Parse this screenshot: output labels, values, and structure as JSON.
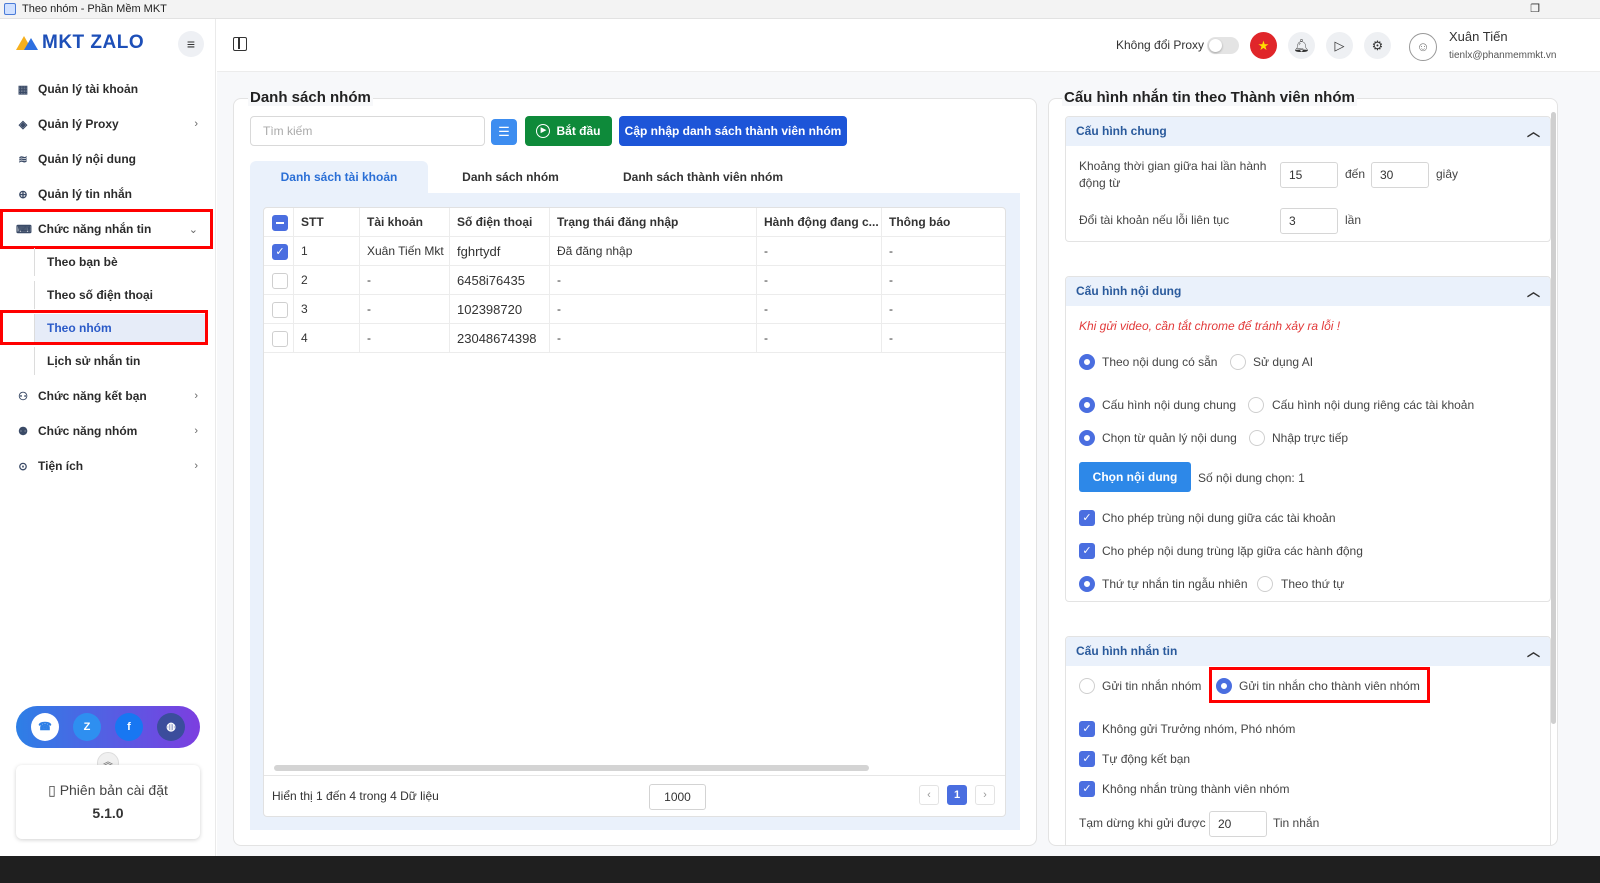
{
  "window": {
    "title": "Theo nhóm - Phần Mềm MKT"
  },
  "sidebar": {
    "logo": "MKT ZALO",
    "items": [
      {
        "label": "Quản lý tài khoản",
        "icon": "grid-icon"
      },
      {
        "label": "Quản lý Proxy",
        "icon": "layers-icon"
      },
      {
        "label": "Quản lý nội dung",
        "icon": "content-icon"
      },
      {
        "label": "Quản lý tin nhắn",
        "icon": "message-search-icon"
      },
      {
        "label": "Chức năng nhắn tin",
        "icon": "chat-icon"
      },
      {
        "label": "Chức năng kết bạn",
        "icon": "user-add-icon"
      },
      {
        "label": "Chức năng nhóm",
        "icon": "group-icon"
      },
      {
        "label": "Tiện ích",
        "icon": "utility-icon"
      }
    ],
    "subitems": [
      {
        "label": "Theo bạn bè"
      },
      {
        "label": "Theo số điện thoại"
      },
      {
        "label": "Theo nhóm"
      },
      {
        "label": "Lịch sử nhắn tin"
      }
    ],
    "version_label": "Phiên bản cài đặt",
    "version": "5.1.0"
  },
  "topbar": {
    "proxy_label": "Không đổi Proxy",
    "user_name": "Xuân Tiến",
    "user_email": "tienlx@phanmemmkt.vn"
  },
  "left": {
    "title": "Danh sách nhóm",
    "search_placeholder": "Tìm kiếm",
    "start_label": "Bắt đầu",
    "update_label": "Cập nhập danh sách thành viên nhóm",
    "tabs": [
      "Danh sách tài khoản",
      "Danh sách nhóm",
      "Danh sách thành viên nhóm"
    ],
    "columns": [
      "STT",
      "Tài khoản",
      "Số điện thoại",
      "Trạng thái đăng nhập",
      "Hành động đang c...",
      "Thông báo"
    ],
    "rows": [
      {
        "stt": "1",
        "account": "Xuân Tiến Mkt",
        "phone": "fghrtydf",
        "status": "Đã đăng nhập",
        "action": "-",
        "note": "-",
        "checked": true
      },
      {
        "stt": "2",
        "account": "-",
        "phone": "6458i76435",
        "status": "-",
        "action": "-",
        "note": "-",
        "checked": false
      },
      {
        "stt": "3",
        "account": "-",
        "phone": "102398720",
        "status": "-",
        "action": "-",
        "note": "-",
        "checked": false
      },
      {
        "stt": "4",
        "account": "-",
        "phone": "23048674398",
        "status": "-",
        "action": "-",
        "note": "-",
        "checked": false
      }
    ],
    "footer_info": "Hiển thị 1 đến 4 trong 4 Dữ liệu",
    "page_size": "1000",
    "current_page": "1"
  },
  "right": {
    "title": "Cấu hình nhắn tin theo Thành viên nhóm",
    "general": {
      "title": "Cấu hình chung",
      "interval_label_1": "Khoảng thời gian giữa hai lần hành",
      "interval_label_2": "động từ",
      "from": "15",
      "to_label": "đến",
      "to": "30",
      "unit": "giây",
      "switch_label": "Đổi tài khoản nếu lỗi liên tục",
      "switch_value": "3",
      "switch_unit": "lần"
    },
    "content": {
      "title": "Cấu hình nội dung",
      "warning": "Khi gửi video, cần tắt chrome để tránh xảy ra lỗi !",
      "opt_available": "Theo nội dung có sẵn",
      "opt_ai": "Sử dụng AI",
      "opt_common": "Cấu hình nội dung chung",
      "opt_private": "Cấu hình nội dung riêng các tài khoản",
      "opt_from_manager": "Chọn từ quản lý nội dung",
      "opt_direct": "Nhập trực tiếp",
      "choose_button": "Chọn nội dung",
      "chosen_count": "Số nội dung chọn: 1",
      "allow_dup_accounts": "Cho phép trùng nội dung giữa các tài khoản",
      "allow_dup_actions": "Cho phép nội dung trùng lặp giữa các hành động",
      "order_random": "Thứ tự nhắn tin ngẫu nhiên",
      "order_seq": "Theo thứ tự"
    },
    "messaging": {
      "title": "Cấu hình nhắn tin",
      "opt_group": "Gửi tin nhắn nhóm",
      "opt_members": "Gửi tin nhắn cho thành viên nhóm",
      "no_admins": "Không gửi Trưởng nhóm, Phó nhóm",
      "auto_friend": "Tự động kết bạn",
      "no_dup_members": "Không nhắn trùng thành viên nhóm",
      "pause_label": "Tạm dừng khi gửi được",
      "pause_value": "20",
      "pause_unit": "Tin nhắn"
    }
  }
}
